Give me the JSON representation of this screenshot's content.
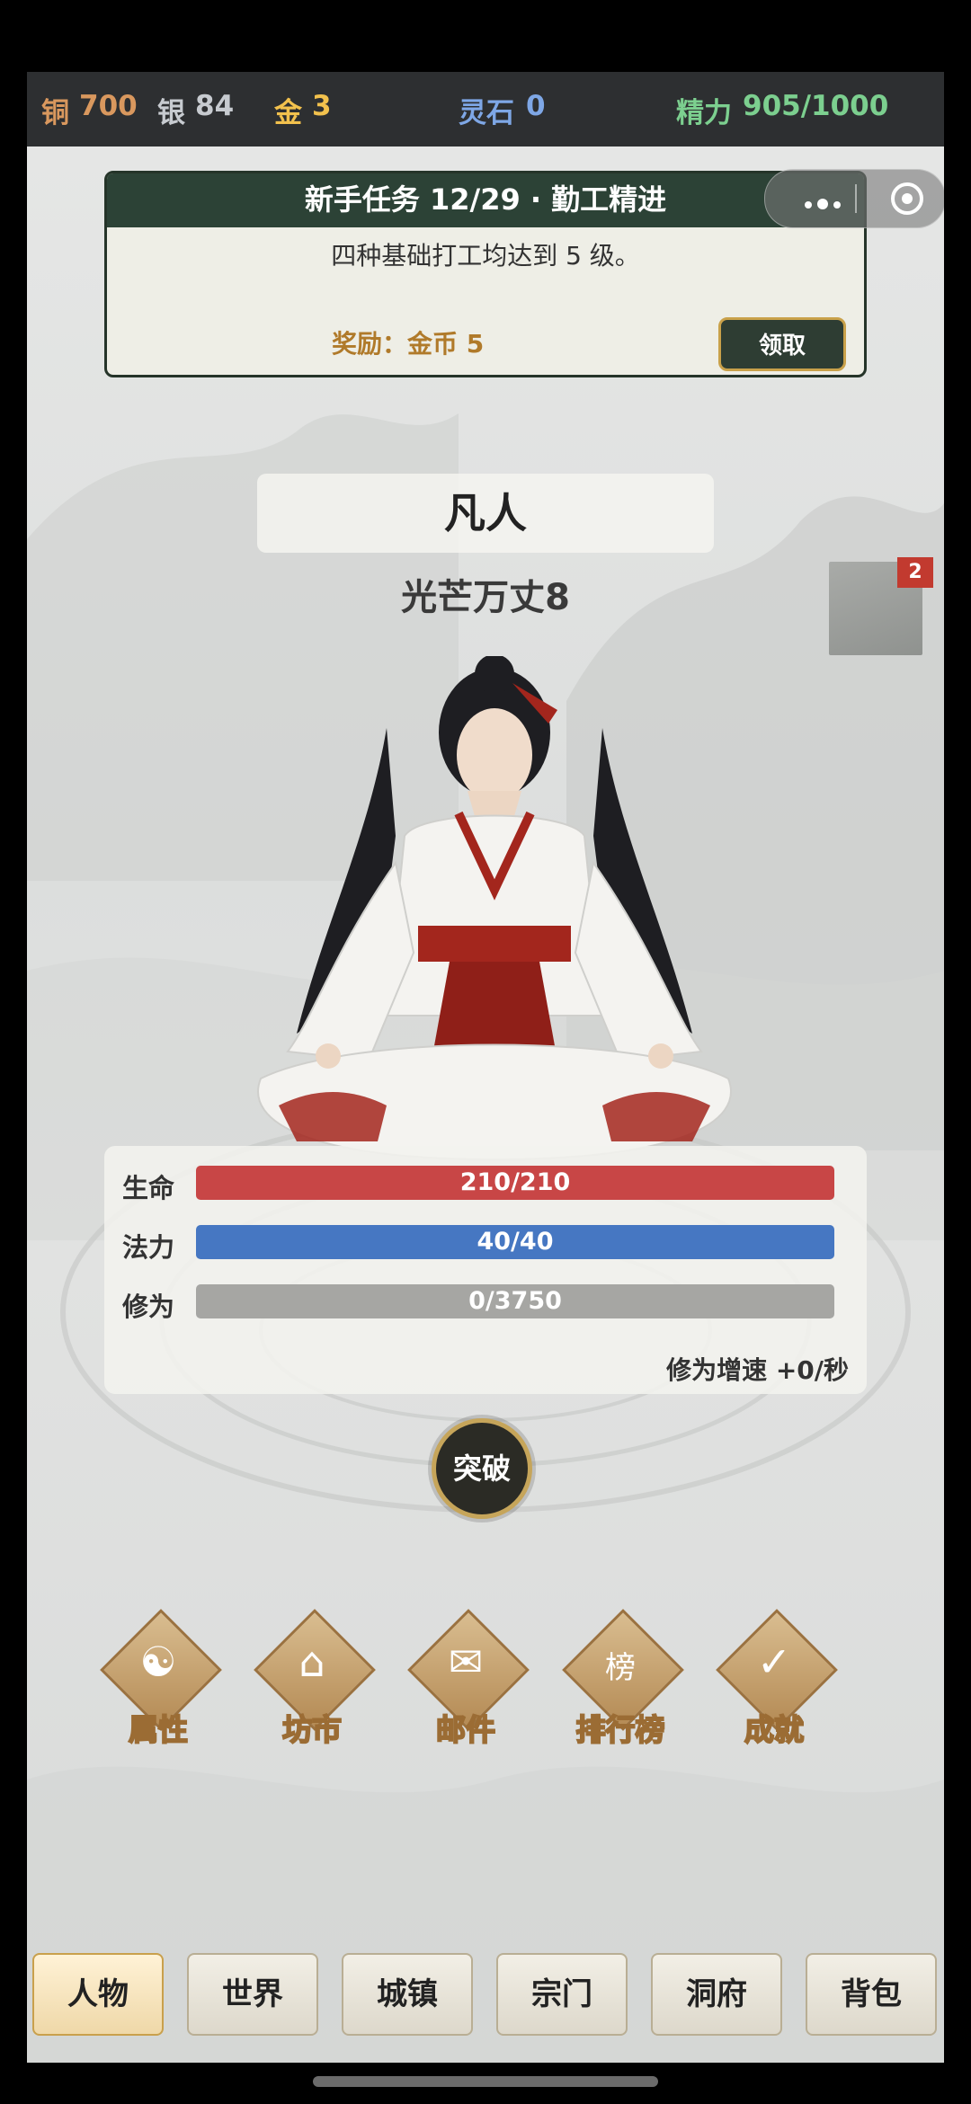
{
  "topbar": {
    "copper_label": "铜",
    "copper_value": "700",
    "silver_label": "银",
    "silver_value": "84",
    "gold_label": "金",
    "gold_value": "3",
    "stone_label": "灵石",
    "stone_value": "0",
    "energy_label": "精力",
    "energy_value": "905/1000"
  },
  "quest": {
    "title": "新手任务 12/29 · 勤工精进",
    "description": "四种基础打工均达到 5 级。",
    "reward": "奖励：金币 5",
    "claim_label": "领取"
  },
  "capsule": {
    "more_icon": "more-dots-icon",
    "close_icon": "target-icon"
  },
  "character": {
    "realm": "凡人",
    "name": "光芒万丈8",
    "side_badge": "2"
  },
  "stats": {
    "hp_label": "生命",
    "hp_value": "210/210",
    "hp_fraction": 1.0,
    "hp_color": "#c84646",
    "mp_label": "法力",
    "mp_value": "40/40",
    "mp_fraction": 1.0,
    "mp_color": "#4677c2",
    "cult_label": "修为",
    "cult_value": "0/3750",
    "cult_fraction": 0.0,
    "cult_color": "#a6a6a3",
    "speed_text": "修为增速 +0/秒"
  },
  "breakthrough_label": "突破",
  "functions": [
    {
      "label": "属性",
      "icon": "yin-yang-icon",
      "glyph": "☯"
    },
    {
      "label": "坊市",
      "icon": "shop-icon",
      "glyph": "⌂"
    },
    {
      "label": "邮件",
      "icon": "dove-icon",
      "glyph": "✉"
    },
    {
      "label": "排行榜",
      "icon": "ranking-icon",
      "glyph": "榜"
    },
    {
      "label": "成就",
      "icon": "achievement-icon",
      "glyph": "✓"
    }
  ],
  "nav": [
    {
      "label": "人物",
      "active": true
    },
    {
      "label": "世界",
      "active": false
    },
    {
      "label": "城镇",
      "active": false
    },
    {
      "label": "宗门",
      "active": false
    },
    {
      "label": "洞府",
      "active": false
    },
    {
      "label": "背包",
      "active": false
    }
  ]
}
